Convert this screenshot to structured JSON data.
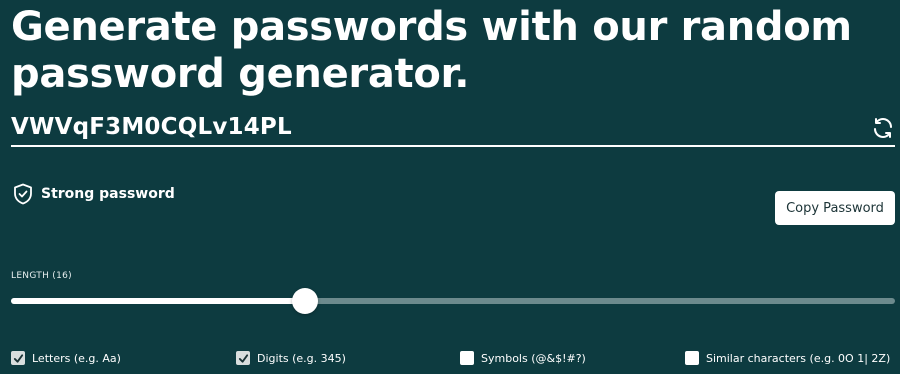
{
  "headline": {
    "line1": "Generate passwords with our random",
    "line2": "password generator."
  },
  "password": {
    "value": "VWVqF3M0CQLv14PL",
    "refresh_icon": "refresh-icon"
  },
  "strength": {
    "icon": "shield-check-icon",
    "label": "Strong password"
  },
  "copy_button": {
    "label": "Copy Password"
  },
  "length": {
    "label": "LENGTH (16)",
    "value": 16,
    "fill_fraction": 0.333
  },
  "options": [
    {
      "label": "Letters (e.g. Aa)",
      "checked": true
    },
    {
      "label": "Digits (e.g. 345)",
      "checked": true
    },
    {
      "label": "Symbols (@&$!#?)",
      "checked": false
    },
    {
      "label": "Similar characters (e.g. 0O 1| 2Z)",
      "checked": false
    }
  ],
  "colors": {
    "background": "#0d3b40",
    "text": "#ffffff",
    "slider_track": "#6c8a8d",
    "button_bg": "#ffffff",
    "button_text": "#1b3336"
  }
}
